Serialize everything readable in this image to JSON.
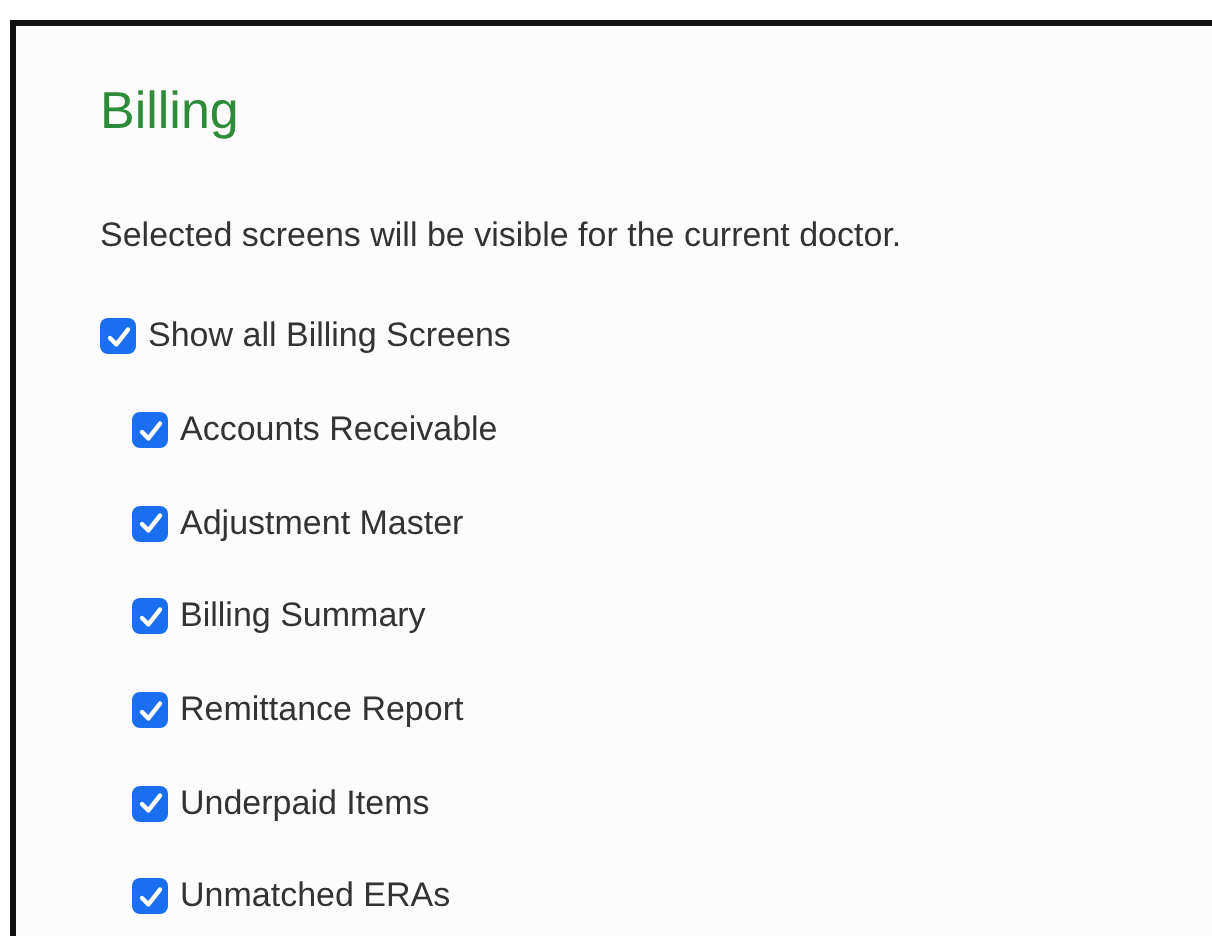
{
  "section": {
    "title": "Billing",
    "description": "Selected screens will be visible for the current doctor.",
    "show_all": {
      "label": "Show all Billing Screens",
      "checked": true,
      "children": [
        {
          "label": "Accounts Receivable",
          "checked": true
        },
        {
          "label": "Adjustment Master",
          "checked": true
        },
        {
          "label": "Billing Summary",
          "checked": true
        },
        {
          "label": "Remittance Report",
          "checked": true
        },
        {
          "label": "Underpaid Items",
          "checked": true
        },
        {
          "label": "Unmatched ERAs",
          "checked": true
        }
      ]
    }
  }
}
